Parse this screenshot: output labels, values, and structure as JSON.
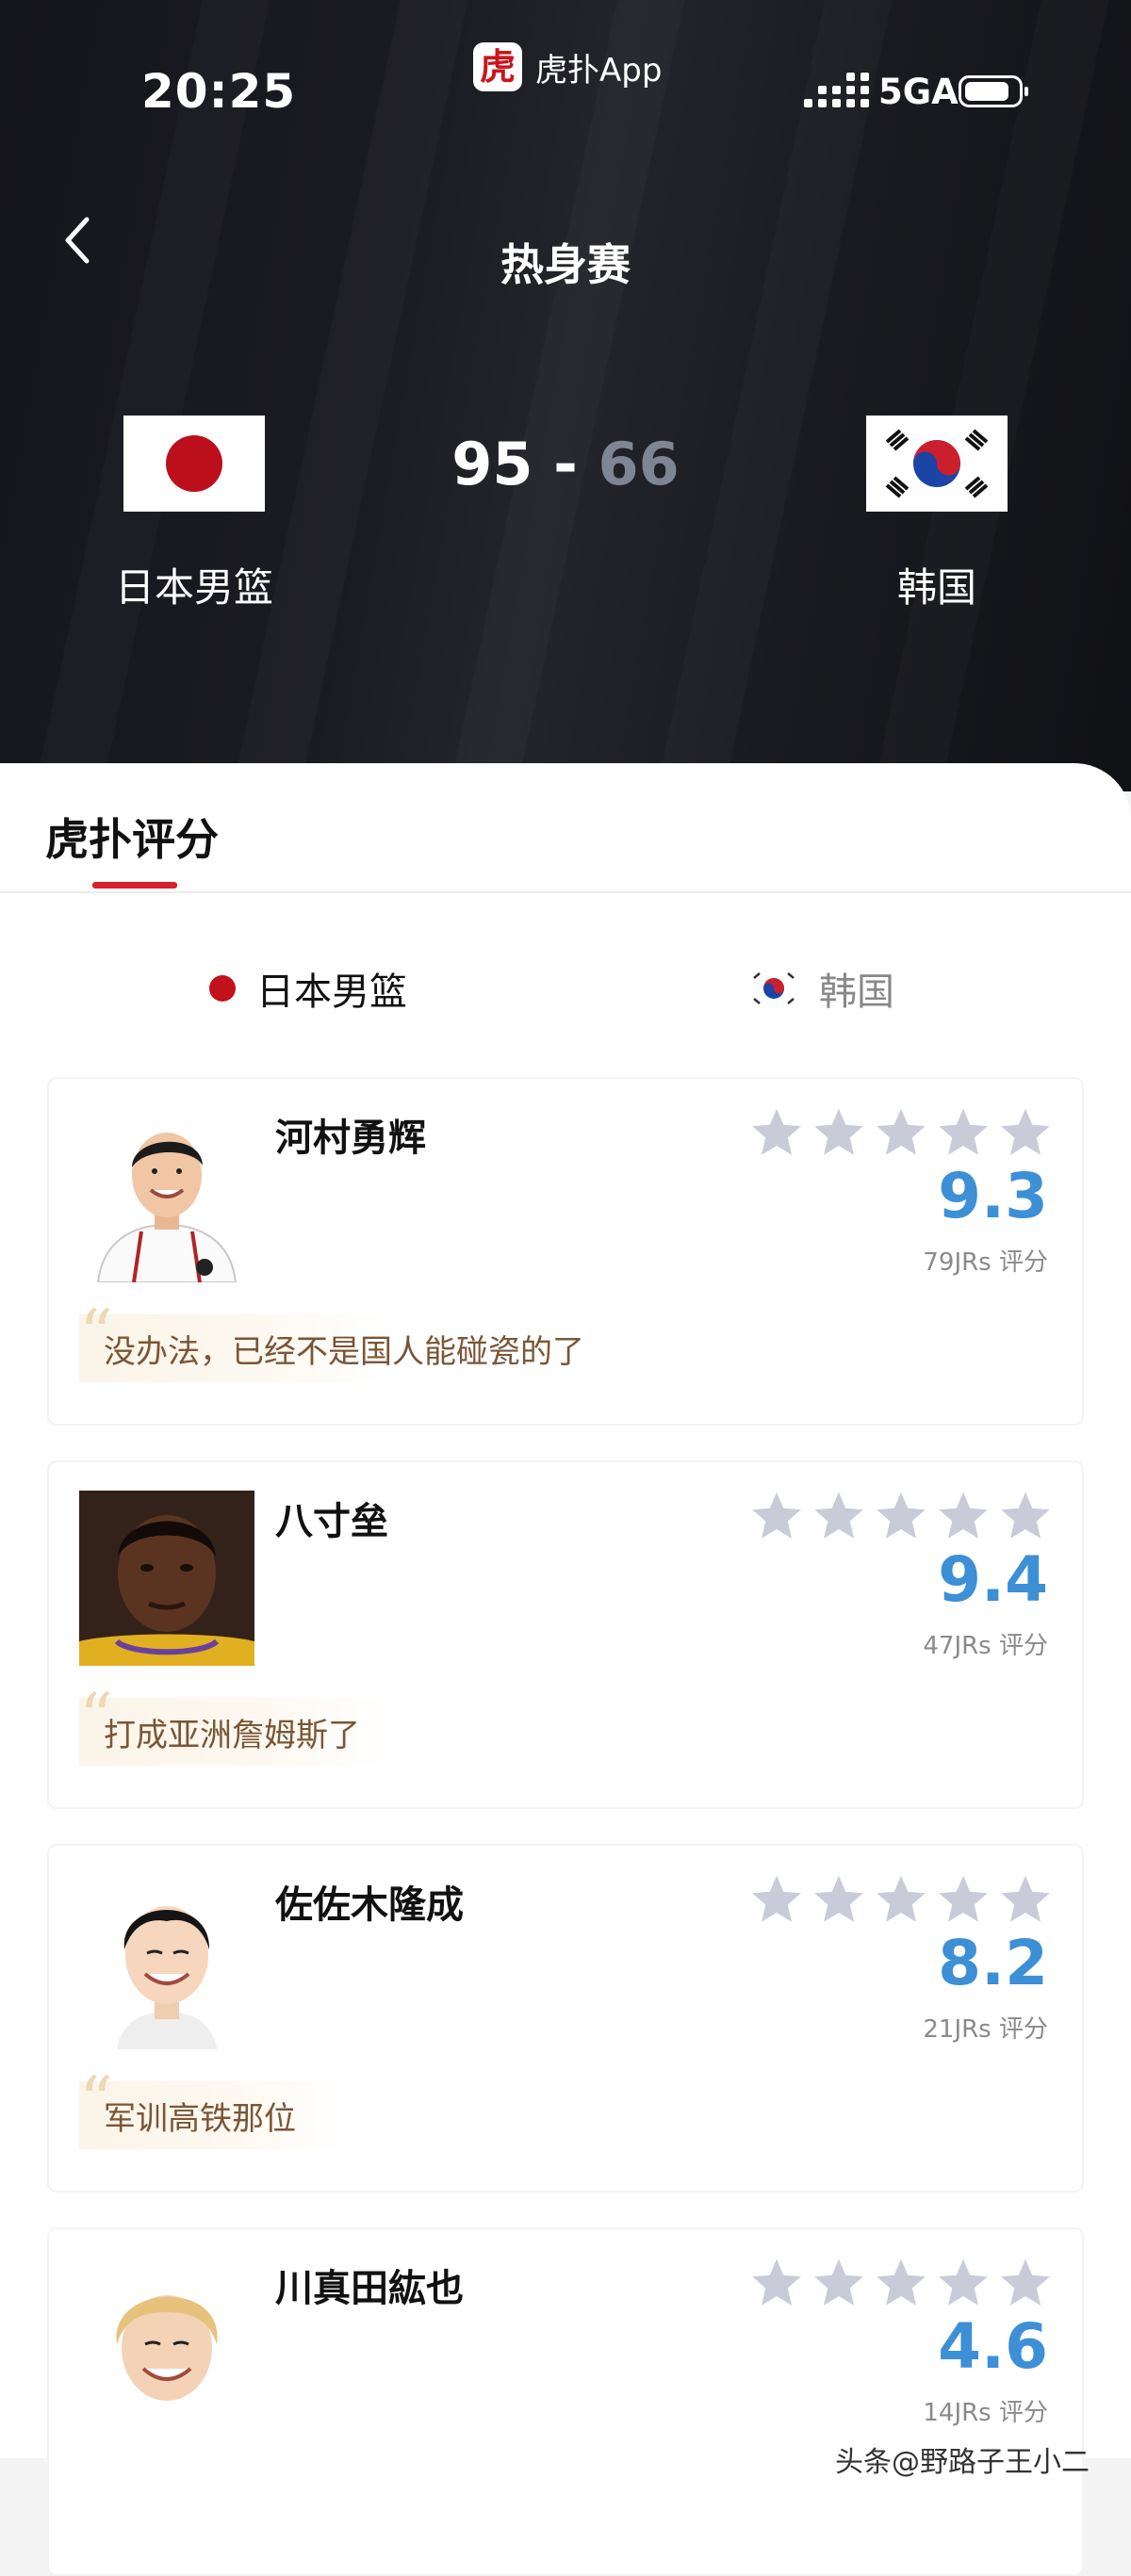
{
  "status": {
    "time": "20:25",
    "app_name": "虎扑App",
    "app_logo_char": "虎",
    "network": "5GA"
  },
  "header": {
    "title": "热身赛"
  },
  "match": {
    "home": {
      "name": "日本男篮",
      "score": "95"
    },
    "away": {
      "name": "韩国",
      "score": "66"
    },
    "separator": "-"
  },
  "tab": {
    "label": "虎扑评分"
  },
  "team_switch": {
    "home": "日本男篮",
    "away": "韩国"
  },
  "players": [
    {
      "name": "河村勇辉",
      "rating": "9.3",
      "votes": "79JRs 评分",
      "comment": "没办法，已经不是国人能碰瓷的了"
    },
    {
      "name": "八寸垒",
      "rating": "9.4",
      "votes": "47JRs 评分",
      "comment": "打成亚洲詹姆斯了"
    },
    {
      "name": "佐佐木隆成",
      "rating": "8.2",
      "votes": "21JRs 评分",
      "comment": "军训高铁那位"
    },
    {
      "name": "川真田紘也",
      "rating": "4.6",
      "votes": "14JRs 评分",
      "comment": ""
    }
  ],
  "watermark": "头条@野路子王小二",
  "colors": {
    "accent_red": "#d8202a",
    "rating_blue": "#3d8fd6",
    "star_gray": "#c9cbd8",
    "header_bg": "#1a1b20"
  }
}
